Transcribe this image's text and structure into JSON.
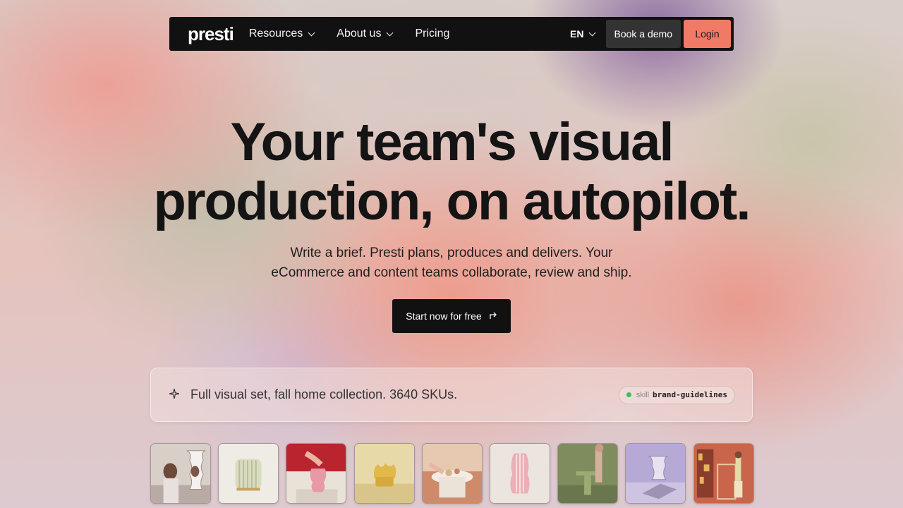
{
  "nav": {
    "logo": "presti",
    "items": [
      {
        "label": "Resources",
        "dropdown": true
      },
      {
        "label": "About us",
        "dropdown": true
      },
      {
        "label": "Pricing",
        "dropdown": false
      }
    ],
    "language": "EN",
    "book_demo": "Book a demo",
    "login": "Login"
  },
  "hero": {
    "title_line1": "Your team's visual",
    "title_line2": "production, on autopilot.",
    "subtitle_line1": "Write a brief. Presti plans, produces and delivers. Your",
    "subtitle_line2": "eCommerce and content teams collaborate, review and ship.",
    "cta": "Start now for free",
    "cta_icon": "arrow-up-right-icon"
  },
  "prompt": {
    "icon": "sparkle-icon",
    "text": "Full visual set, fall home collection. 3640 SKUs.",
    "skill_label": "skill",
    "skill_value": "brand-guidelines",
    "skill_status_color": "#3cbf5a"
  },
  "thumbnails": [
    {
      "name": "women-wavy-mirror"
    },
    {
      "name": "striped-stool"
    },
    {
      "name": "hand-pink-vase"
    },
    {
      "name": "yellow-armchair"
    },
    {
      "name": "round-table-setting"
    },
    {
      "name": "pink-ribbed-vase"
    },
    {
      "name": "green-side-table"
    },
    {
      "name": "wavy-mirror-lavender"
    },
    {
      "name": "bookshelf-person"
    }
  ],
  "colors": {
    "nav_bg": "#111111",
    "login_accent": "#f07a66",
    "demo_bg": "#333333"
  }
}
